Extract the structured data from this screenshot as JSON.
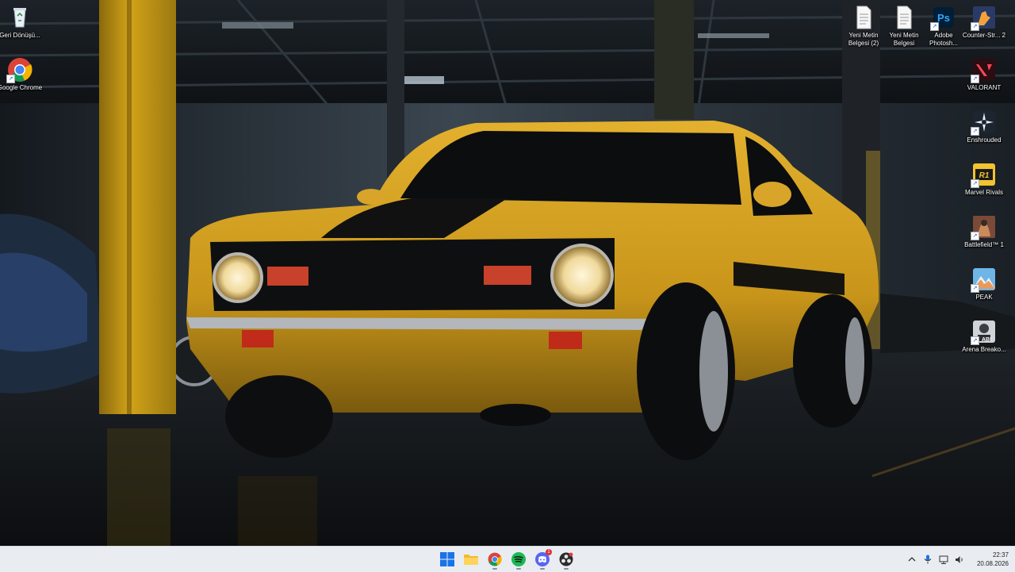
{
  "desktop": {
    "left_icons": [
      {
        "label": "Geri Dönüşü...",
        "icon": "recycle-bin-icon"
      },
      {
        "label": "Google Chrome",
        "icon": "chrome-icon"
      }
    ],
    "right_top_icons": [
      {
        "label": "Yeni Metin Belgesi (2)",
        "icon": "text-document-icon"
      },
      {
        "label": "Yeni Metin Belgesi",
        "icon": "text-document-icon"
      },
      {
        "label": "Adobe Photosh...",
        "icon": "photoshop-icon",
        "badge_text": "Ps"
      },
      {
        "label": "Counter-Str... 2",
        "icon": "counter-strike-icon"
      }
    ],
    "right_column_icons": [
      {
        "label": "VALORANT",
        "icon": "valorant-icon"
      },
      {
        "label": "Enshrouded",
        "icon": "enshrouded-icon"
      },
      {
        "label": "Marvel Rivals",
        "icon": "marvel-rivals-icon",
        "badge_text": "R1"
      },
      {
        "label": "Battlefield™ 1",
        "icon": "battlefield-icon"
      },
      {
        "label": "PEAK",
        "icon": "peak-icon"
      },
      {
        "label": "Arena Breako...",
        "icon": "arena-breakout-icon",
        "badge_text": "ABI"
      }
    ]
  },
  "taskbar": {
    "apps": [
      {
        "name": "start",
        "icon": "windows-start-icon"
      },
      {
        "name": "file-explorer",
        "icon": "folder-icon"
      },
      {
        "name": "chrome",
        "icon": "chrome-icon"
      },
      {
        "name": "spotify",
        "icon": "spotify-icon"
      },
      {
        "name": "discord",
        "icon": "discord-icon",
        "badge": "1"
      },
      {
        "name": "obs",
        "icon": "obs-icon"
      }
    ],
    "tray": {
      "icons": [
        "chevron-up-icon",
        "microphone-icon",
        "network-icon",
        "speaker-icon"
      ],
      "time": "22:37",
      "date": "20.08.2026"
    }
  },
  "colors": {
    "taskbar_bg": "#e9edf2",
    "car_yellow": "#d9a521",
    "pillar_yellow": "#c79a13",
    "windows_blue": "#1a73e8"
  }
}
